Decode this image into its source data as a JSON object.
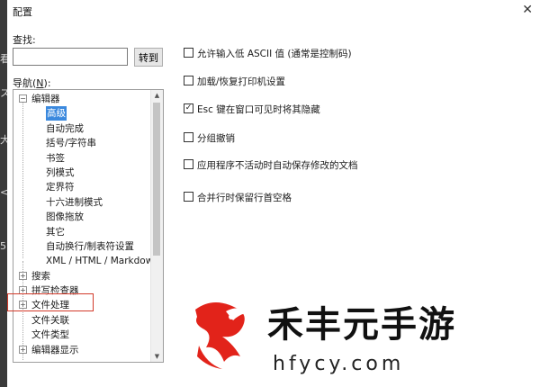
{
  "window": {
    "title": "配置",
    "close_glyph": "✕"
  },
  "left_strip": {
    "marks": [
      "看",
      "ス",
      "大",
      "<",
      "5"
    ]
  },
  "find": {
    "label": "查找:",
    "value": "",
    "goto_label": "转到"
  },
  "nav": {
    "label_prefix": "导航(",
    "label_key": "N",
    "label_suffix": "):"
  },
  "tree": {
    "items": [
      {
        "label": "编辑器",
        "expander": "−",
        "level": 0
      },
      {
        "label": "高级",
        "level": 1,
        "selected": true
      },
      {
        "label": "自动完成",
        "level": 1
      },
      {
        "label": "括号/字符串",
        "level": 1
      },
      {
        "label": "书签",
        "level": 1
      },
      {
        "label": "列模式",
        "level": 1
      },
      {
        "label": "定界符",
        "level": 1
      },
      {
        "label": "十六进制模式",
        "level": 1
      },
      {
        "label": "图像拖放",
        "level": 1
      },
      {
        "label": "其它",
        "level": 1
      },
      {
        "label": "自动换行/制表符设置",
        "level": 1
      },
      {
        "label": "XML / HTML / Markdow",
        "level": 1
      },
      {
        "label": "搜索",
        "expander": "+",
        "level": 0
      },
      {
        "label": "拼写检查器",
        "expander": "+",
        "level": 0
      },
      {
        "label": "文件处理",
        "expander": "+",
        "level": 0
      },
      {
        "label": "文件关联",
        "level": 0
      },
      {
        "label": "文件类型",
        "level": 0
      },
      {
        "label": "编辑器显示",
        "expander": "+",
        "level": 0
      }
    ],
    "scroll_up_glyph": "▲",
    "scroll_down_glyph": "▼"
  },
  "options": [
    {
      "label": "允许输入低 ASCII 值 (通常是控制码)",
      "checked": false
    },
    {
      "label": "加载/恢复打印机设置",
      "checked": false
    },
    {
      "label": "Esc 键在窗口可见时将其隐藏",
      "checked": true
    },
    {
      "label": "分组撤销",
      "checked": false
    },
    {
      "label": "应用程序不活动时自动保存修改的文档",
      "checked": false
    },
    {
      "label": "合并行时保留行首空格",
      "checked": false
    }
  ],
  "watermark": {
    "brand": "禾丰元手游",
    "url": "hfycy.com"
  },
  "colors": {
    "selection": "#3b89de",
    "highlight_border": "#d23a2a",
    "logo_red": "#e2231a"
  }
}
